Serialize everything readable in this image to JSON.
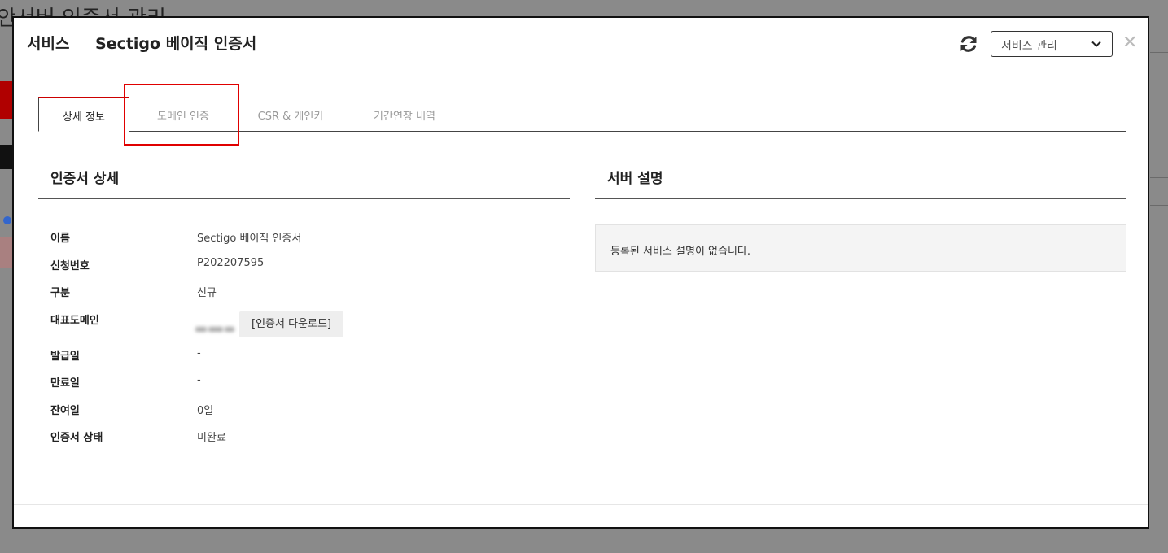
{
  "background": {
    "page_title": "안서버 인증서 관리"
  },
  "header": {
    "service_label": "서비스",
    "product_title": "Sectigo 베이직 인증서",
    "manage_select": "서비스 관리",
    "close_glyph": "✕"
  },
  "tabs": [
    {
      "label": "상세 정보",
      "active": true
    },
    {
      "label": "도메인 인증",
      "active": false
    },
    {
      "label": "CSR & 개인키",
      "active": false
    },
    {
      "label": "기간연장 내역",
      "active": false
    }
  ],
  "cert_detail": {
    "title": "인증서 상세",
    "rows": [
      {
        "label": "이름",
        "value": "Sectigo 베이직 인증서"
      },
      {
        "label": "신청번호",
        "value": "P202207595"
      },
      {
        "label": "구분",
        "value": "신규"
      },
      {
        "label": "대표도메인",
        "value": ""
      },
      {
        "label": "발급일",
        "value": "-"
      },
      {
        "label": "만료일",
        "value": "-"
      },
      {
        "label": "잔여일",
        "value": "0일"
      },
      {
        "label": "인증서 상태",
        "value": "미완료"
      }
    ],
    "download_button": "[인증서 다운로드]"
  },
  "server_desc": {
    "title": "서버 설명",
    "message": "등록된 서비스 설명이 없습니다."
  },
  "colors": {
    "accent_red": "#cc0000",
    "highlight_red": "#e00000",
    "border_dark": "#444444"
  }
}
